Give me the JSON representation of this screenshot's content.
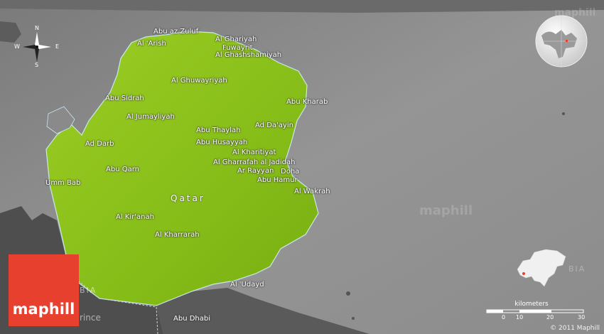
{
  "country_name": "Qatar",
  "places": [
    {
      "id": "abu-az-zuluf",
      "name": "Abu az Zuluf"
    },
    {
      "id": "al-ghariyah",
      "name": "Al Ghariyah"
    },
    {
      "id": "al-arish",
      "name": "Al 'Arish"
    },
    {
      "id": "fuwayrit",
      "name": "Fuwayrit"
    },
    {
      "id": "al-ghashshamiyah",
      "name": "Al Ghashshamiyah"
    },
    {
      "id": "al-ghuwayriyah",
      "name": "Al Ghuwayriyah"
    },
    {
      "id": "abu-sidrah",
      "name": "Abu Sidrah"
    },
    {
      "id": "abu-kharab",
      "name": "Abu Kharab"
    },
    {
      "id": "al-jumayliyah",
      "name": "Al Jumayliyah"
    },
    {
      "id": "ad-dayin",
      "name": "Ad Da'ayin"
    },
    {
      "id": "abu-thaylah",
      "name": "Abu Thaylah"
    },
    {
      "id": "ad-darb",
      "name": "Ad Darb"
    },
    {
      "id": "abu-husayyah",
      "name": "Abu Husayyah"
    },
    {
      "id": "al-kharitiyat",
      "name": "Al Kharitiyat"
    },
    {
      "id": "al-gharrafah",
      "name": "Al Gharrafah al Jadidah"
    },
    {
      "id": "abu-qarn",
      "name": "Abu Qarn"
    },
    {
      "id": "ar-rayyan",
      "name": "Ar Rayyan"
    },
    {
      "id": "doha",
      "name": "Doha"
    },
    {
      "id": "abu-hamur",
      "name": "Abu Hamur"
    },
    {
      "id": "umm-bab",
      "name": "Umm Bab"
    },
    {
      "id": "al-wakrah",
      "name": "Al Wakrah"
    },
    {
      "id": "al-kiranah",
      "name": "Al Kir'anah"
    },
    {
      "id": "al-kharrarah",
      "name": "Al Kharrarah"
    },
    {
      "id": "al-udayd",
      "name": "Al 'Udayd"
    },
    {
      "id": "abu-dhabi",
      "name": "Abu Dhabi"
    }
  ],
  "partial_labels": {
    "bia_left": "BIA",
    "bia_right": "BIA",
    "rince": "rince"
  },
  "watermarks": [
    "maphill",
    "maphill"
  ],
  "compass": {
    "n": "N",
    "s": "S",
    "e": "E",
    "w": "W"
  },
  "scale": {
    "title": "kilometers",
    "ticks": [
      "0",
      "10",
      "20",
      "30"
    ]
  },
  "logo_text": "maphill",
  "copyright": "© 2011 Maphill",
  "colors": {
    "land": "#8cc11c",
    "sea": "#8a8a8a",
    "foreign_land": "#4a4a4a",
    "logo": "#e8402f"
  }
}
